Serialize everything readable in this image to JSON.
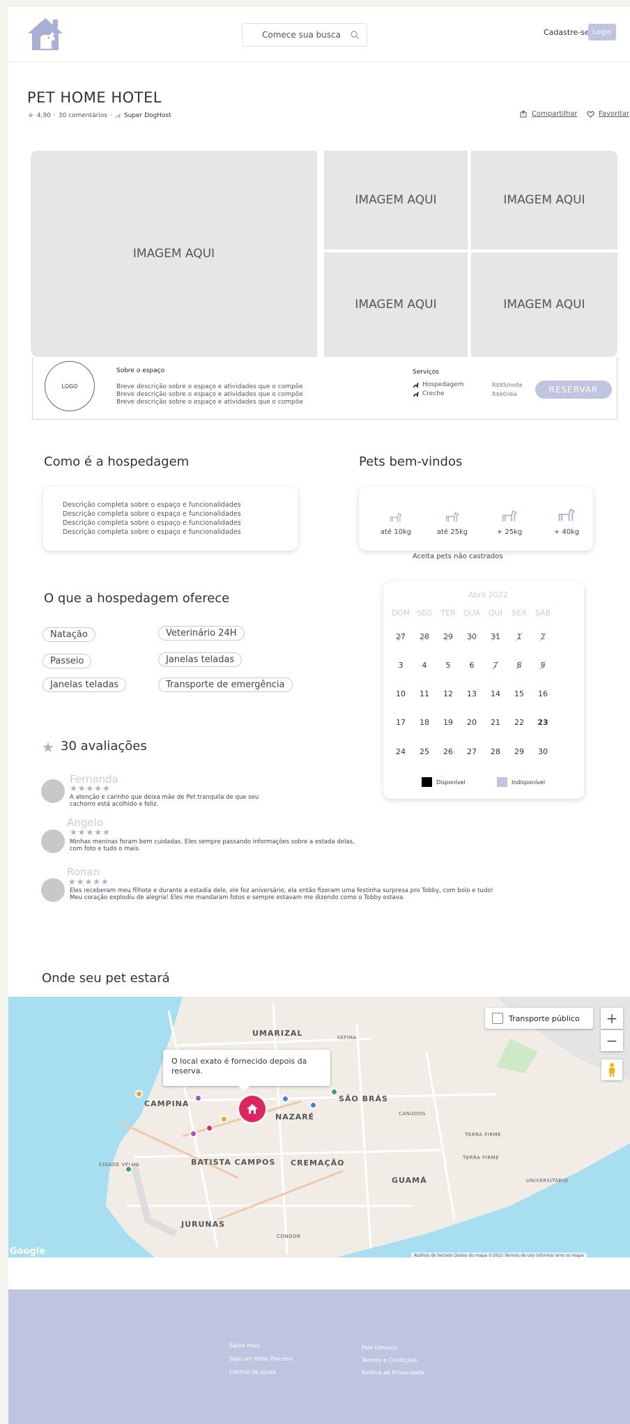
{
  "header": {
    "search_placeholder": "Comece sua busca",
    "signup_label": "Cadastre-se",
    "login_label": "Login"
  },
  "listing": {
    "title": "PET HOME HOTEL",
    "rating": "4,90",
    "comments": "30 comentários",
    "host_badge": "Super DogHost",
    "share_label": "Compartilhar",
    "favorite_label": "Favoritar"
  },
  "gallery": {
    "main": "IMAGEM AQUI",
    "thumbs": [
      "IMAGEM AQUI",
      "IMAGEM AQUI",
      "IMAGEM AQUI",
      "IMAGEM AQUI"
    ]
  },
  "info": {
    "logo_label": "LOGO",
    "about_title": "Sobre o espaço",
    "about_lines": [
      "Breve descrição sobre o espaço e atividades que o compõe",
      "Breve descrição sobre o espaço e atividades que o compõe",
      "Breve descrição sobre o espaço e atividades que o compõe"
    ],
    "services_title": "Serviços",
    "services": [
      {
        "name": "Hospedagem",
        "price": "R$85/noite"
      },
      {
        "name": "Creche",
        "price": "R$60/dia"
      }
    ],
    "reserve_label": "RESERVAR"
  },
  "stay": {
    "title": "Como é a hospedagem",
    "lines": [
      "Descrição completa sobre o espaço e funcionalidades",
      "Descrição completa sobre o espaço e funcionalidades",
      "Descrição completa sobre o espaço e funcionalidades",
      "Descrição completa sobre o espaço e funcionalidades"
    ]
  },
  "pets": {
    "title": "Pets bem-vindos",
    "sizes": [
      "até 10kg",
      "até 25kg",
      "+ 25kg",
      "+ 40kg"
    ],
    "note": "Aceita pets não castrados"
  },
  "amenities": {
    "title": "O que a hospedagem oferece",
    "items": [
      "Natação",
      "Veterinário 24H",
      "Passeio",
      "Janelas teladas",
      "Janelas teladas",
      "Transporte de emergência"
    ]
  },
  "calendar": {
    "month": "Abril 2022",
    "weekdays": [
      "DOM",
      "SEG",
      "TER",
      "QUA",
      "QUI",
      "SEX",
      "SÁB"
    ],
    "weeks": [
      [
        "27",
        "28",
        "29",
        "30",
        "31",
        "1",
        "2"
      ],
      [
        "3",
        "4",
        "5",
        "6",
        "7",
        "8",
        "9"
      ],
      [
        "10",
        "11",
        "12",
        "13",
        "14",
        "15",
        "16"
      ],
      [
        "17",
        "18",
        "19",
        "20",
        "21",
        "22",
        "23"
      ],
      [
        "24",
        "25",
        "26",
        "27",
        "28",
        "29",
        "30"
      ]
    ],
    "legend_available": "Disponível",
    "legend_unavailable": "Indisponível",
    "color_available": "#000000",
    "color_unavailable": "#bfc5e0"
  },
  "reviews": {
    "title": "30 avaliações",
    "items": [
      {
        "name": "Fernanda",
        "stars": "★★★★★",
        "line1": "A atenção e carinho que deixa mãe de Pet tranquila de que seu",
        "line2": "cachorro está acolhido e feliz."
      },
      {
        "name": "Angelo",
        "stars": "★★★★★",
        "line1": "Minhas meninas foram bem cuidadas. Eles sempre passando informações sobre a estada delas,",
        "line2": "com foto e tudo o mais."
      },
      {
        "name": "Ronan",
        "stars": "★★★★★",
        "line1": "Eles receberam meu filhote e durante a estadia dele, ele fez aniversário, ela então fizeram uma festinha surpresa pro Tobby, com bolo e tudo!",
        "line2": "Meu coração explodiu de alegria! Eles me mandaram fotos e sempre estavam me dizendo como o Tobby estava."
      }
    ]
  },
  "map": {
    "title": "Onde seu pet estará",
    "tooltip": "O local exato é fornecido depois da reserva.",
    "transport_label": "Transporte público",
    "zoom_in": "+",
    "zoom_out": "−",
    "google": "Google",
    "attribution": "Atalhos do teclado   Dados do mapa ©2022   Termos de Uso   Informar erro no mapa",
    "labels": [
      "UMARIZAL",
      "FÁTIMA",
      "CAMPINA",
      "NAZARÉ",
      "SÃO BRÁS",
      "CANUDOS",
      "TERRA FIRME",
      "TERRA FIRME",
      "BATISTA CAMPOS",
      "CREMAÇÃO",
      "CIDADE VELHA",
      "GUAMÁ",
      "UNIVERSITÁRIO",
      "JURUNAS",
      "CONDOR"
    ]
  },
  "footer": {
    "col1": [
      "Saiba mais",
      "Seja um Hotel Parceiro",
      "Central de ajuda"
    ],
    "col2": [
      "Fale conosco",
      "Termos e Condições",
      "Política de Privacidade"
    ]
  }
}
